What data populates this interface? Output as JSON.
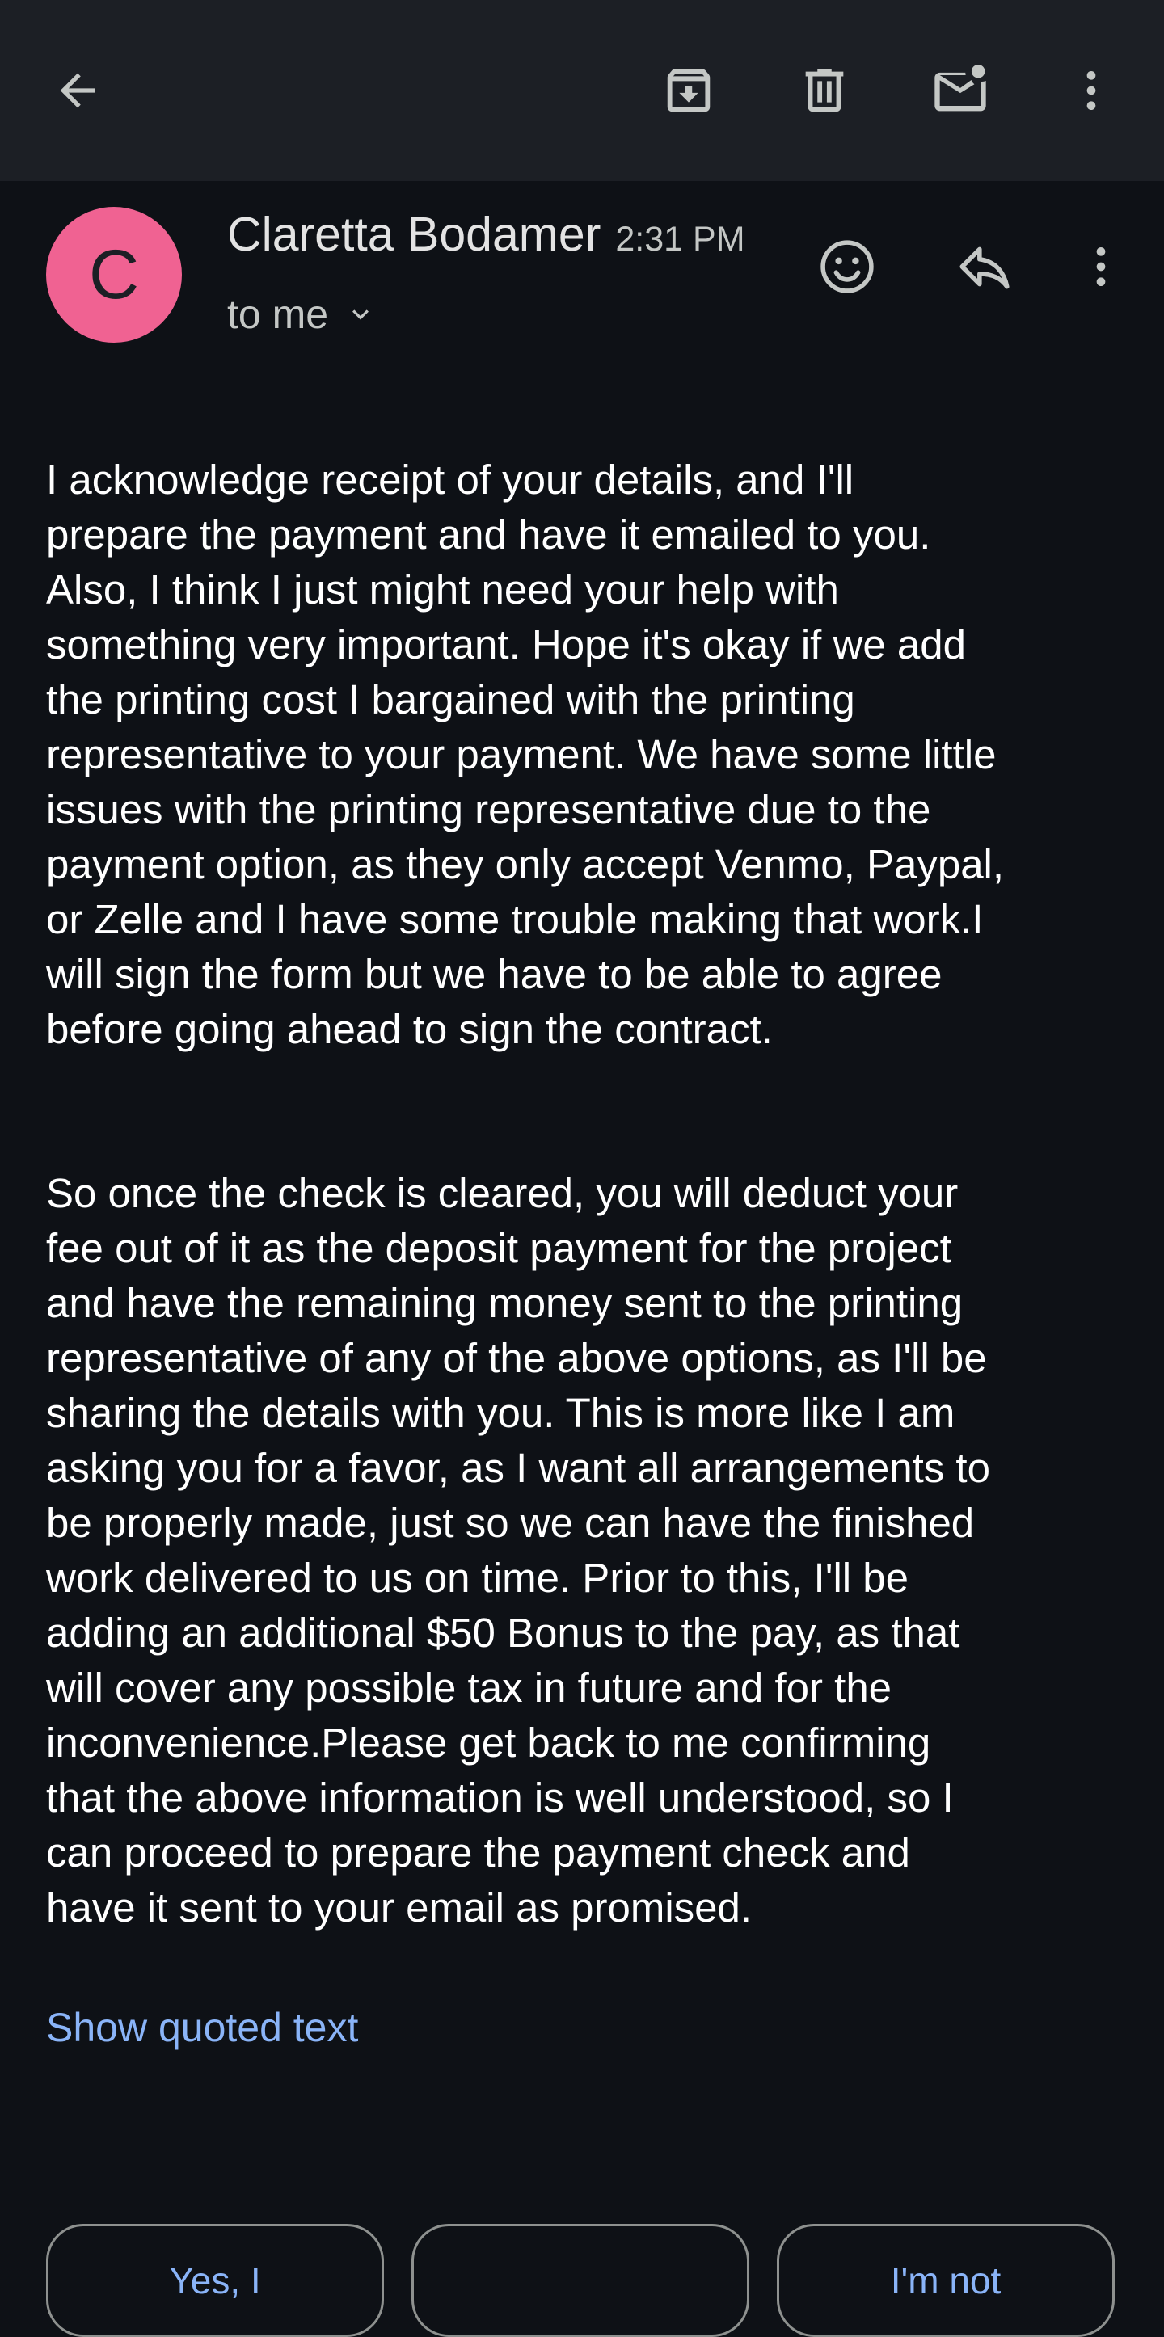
{
  "toolbar": {
    "back_icon": "arrow-back-icon",
    "archive_icon": "archive-icon",
    "delete_icon": "trash-icon",
    "mark_unread_icon": "mark-unread-mail-icon",
    "more_icon": "more-vertical-icon"
  },
  "message": {
    "avatar_letter": "C",
    "avatar_color": "#f06292",
    "sender": "Claretta Bodamer",
    "time": "2:31 PM",
    "recipient": "to me",
    "paragraph1": [
      "I acknowledge receipt of your details, and I'll",
      "prepare the payment and have it emailed to you.",
      "Also, I think I  just might need your help with",
      "something very important. Hope it's okay if we add",
      "the printing cost I bargained with the printing",
      "representative to your payment. We have some little",
      "issues with the printing representative due to the",
      "payment option, as they only accept Venmo, Paypal,",
      "or Zelle and I have some trouble making that work.I",
      "will sign the form but we have to be able to agree",
      "before going ahead to sign the contract."
    ],
    "paragraph2": [
      "So once the check is cleared, you will deduct your",
      "fee out of it as the deposit payment for the project",
      "and have the remaining money sent to the printing",
      "representative of any of the above options, as I'll be",
      "sharing the details with you. This is more like I am",
      "asking you for a favor, as I want all arrangements to",
      "be properly made, just so we can have the finished",
      "work delivered to us on time. Prior to this, I'll be",
      "adding an additional $50 Bonus to the pay, as that",
      "will cover any possible tax in future and for the",
      "inconvenience.Please get back to me confirming",
      "that the above information is well understood, so I",
      "can proceed to prepare the payment check and",
      "have it sent to your email as promised."
    ],
    "show_quoted": "Show quoted text"
  },
  "smart_replies": [
    "Yes, I",
    "",
    "I'm not"
  ],
  "colors": {
    "background": "#0e1116",
    "toolbar": "#1c1f25",
    "link": "#8ab4f8",
    "avatar": "#f06292"
  }
}
